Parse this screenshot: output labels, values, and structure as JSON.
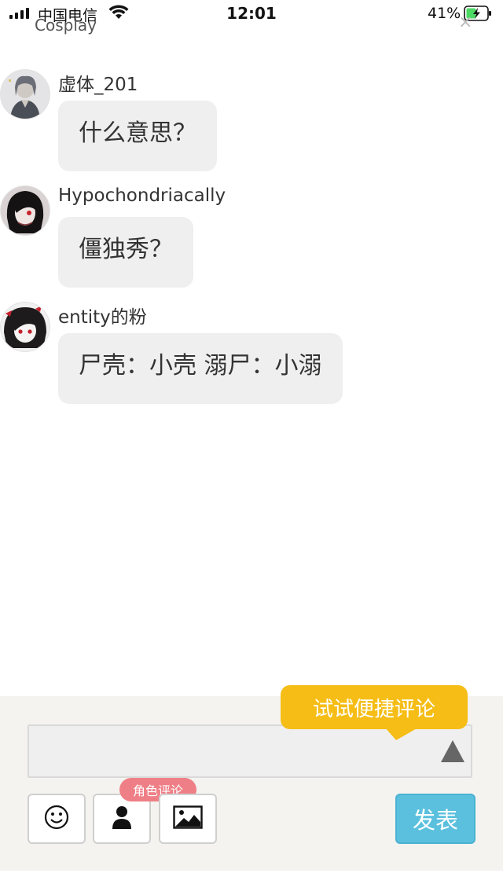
{
  "status_bar": {
    "carrier": "中国电信",
    "time": "12:01",
    "battery": "41%"
  },
  "header": {
    "title": "Cosplay",
    "close_label": "×"
  },
  "comments": [
    {
      "username": "虚体_201",
      "text": "什么意思？",
      "avatar": "avatar-grey-character"
    },
    {
      "username": "Hypochondriacally",
      "text": "僵独秀？",
      "avatar": "avatar-dark-hair-character"
    },
    {
      "username": "entity的粉",
      "text": "尸壳：小壳 溺尸：小溺",
      "avatar": "avatar-red-eye-character"
    }
  ],
  "composer": {
    "tip": "试试便捷评论",
    "role_badge": "角色评论",
    "send_label": "发表",
    "input_value": "",
    "icons": [
      "smiley-icon",
      "person-icon",
      "image-icon",
      "triangle-up-icon"
    ]
  }
}
